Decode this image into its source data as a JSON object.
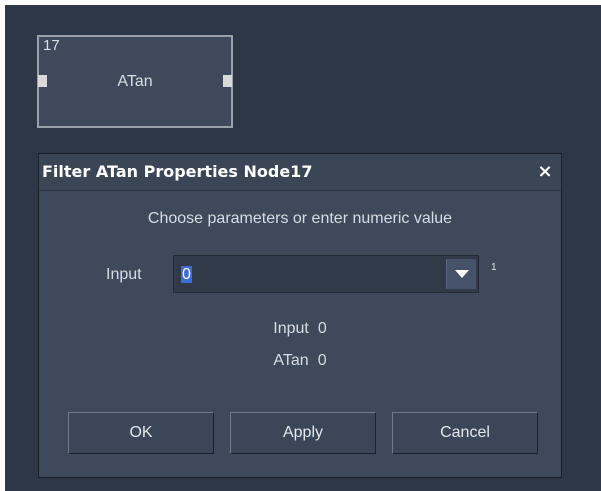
{
  "node": {
    "id": "17",
    "title": "ATan"
  },
  "dialog": {
    "title": "Filter ATan Properties Node17",
    "close_glyph": "×",
    "instruction": "Choose parameters or enter numeric value",
    "input_label": "Input",
    "input_value": "0",
    "input_superscript": "1",
    "dropdown_icon": "chevron-down-icon",
    "values": [
      {
        "label": "Input",
        "value": "0"
      },
      {
        "label": "ATan",
        "value": "0"
      }
    ],
    "buttons": {
      "ok": "OK",
      "apply": "Apply",
      "cancel": "Cancel"
    }
  },
  "colors": {
    "canvas_bg": "#2e3747",
    "panel_bg": "#3e4a5c",
    "selection": "#3a6fd8"
  }
}
